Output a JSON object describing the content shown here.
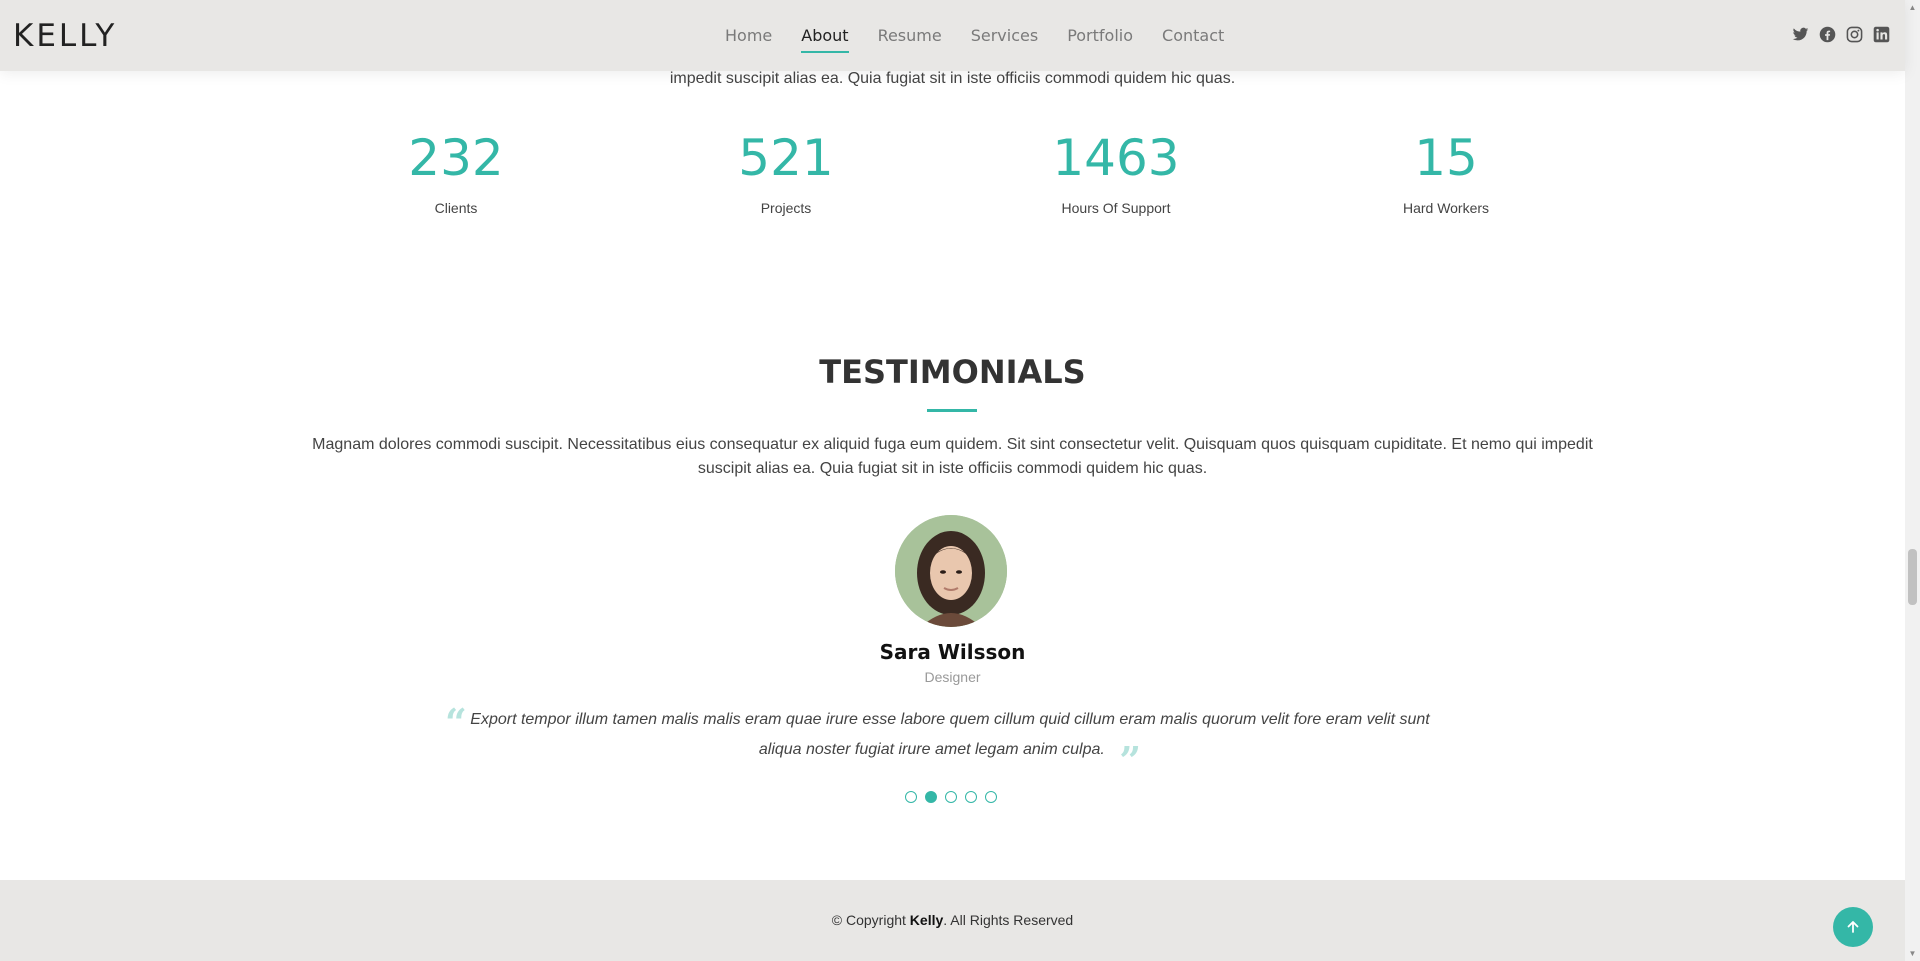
{
  "header": {
    "logo": "KELLY",
    "nav": [
      {
        "label": "Home",
        "active": false
      },
      {
        "label": "About",
        "active": true
      },
      {
        "label": "Resume",
        "active": false
      },
      {
        "label": "Services",
        "active": false
      },
      {
        "label": "Portfolio",
        "active": false
      },
      {
        "label": "Contact",
        "active": false
      }
    ],
    "social": [
      "twitter-icon",
      "facebook-icon",
      "instagram-icon",
      "linkedin-icon"
    ]
  },
  "about": {
    "intro_tail": "impedit suscipit alias ea. Quia fugiat sit in iste officiis commodi quidem hic quas."
  },
  "counts": [
    {
      "value": "232",
      "label": "Clients"
    },
    {
      "value": "521",
      "label": "Projects"
    },
    {
      "value": "1463",
      "label": "Hours Of Support"
    },
    {
      "value": "15",
      "label": "Hard Workers"
    }
  ],
  "testimonials": {
    "title": "TESTIMONIALS",
    "description": "Magnam dolores commodi suscipit. Necessitatibus eius consequatur ex aliquid fuga eum quidem. Sit sint consectetur velit. Quisquam quos quisquam cupiditate. Et nemo qui impedit suscipit alias ea. Quia fugiat sit in iste officiis commodi quidem hic quas.",
    "name": "Sara Wilsson",
    "role": "Designer",
    "quote": "Export tempor illum tamen malis malis eram quae irure esse labore quem cillum quid cillum eram malis quorum velit fore eram velit sunt aliqua noster fugiat irure amet legam anim culpa.",
    "quote_open": "“",
    "quote_close": "”",
    "pagination_count": 5,
    "active_index": 1
  },
  "footer": {
    "copyright_prefix": "© Copyright ",
    "brand": "Kelly",
    "copyright_suffix": ". All Rights Reserved",
    "back_to_top_icon": "arrow-up-icon"
  },
  "colors": {
    "accent": "#34b7a7",
    "header_bg": "#e8e7e5",
    "text": "#444444"
  }
}
